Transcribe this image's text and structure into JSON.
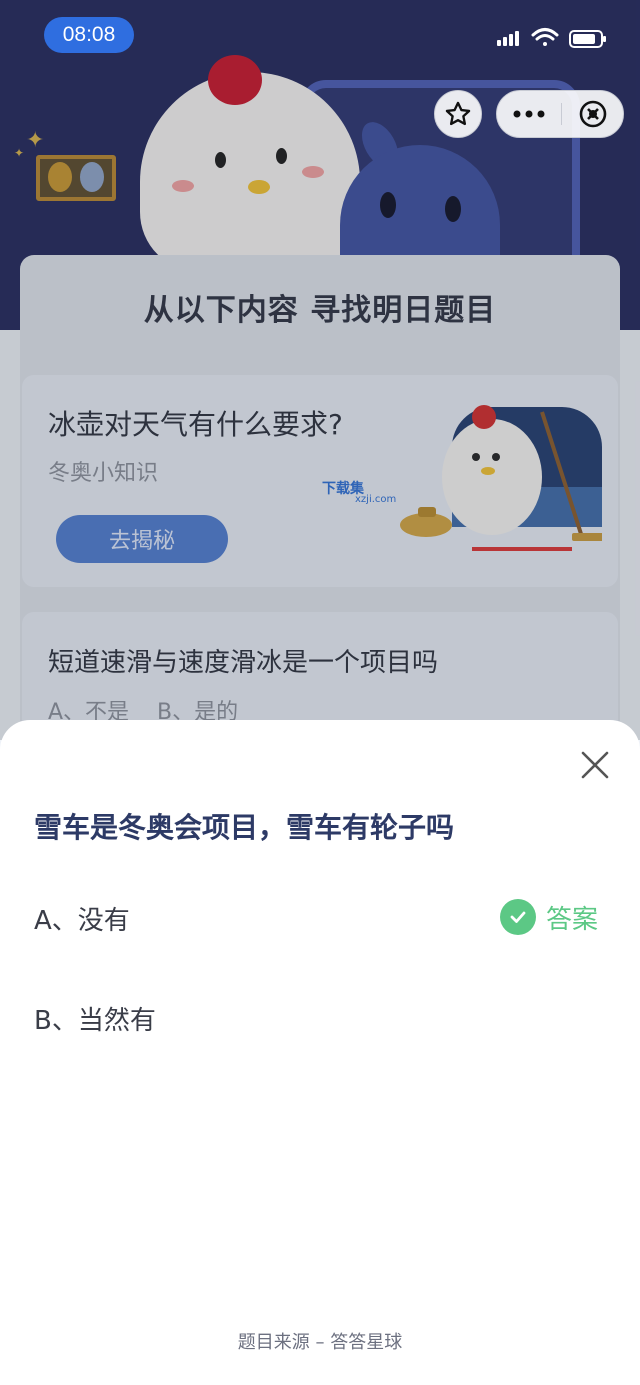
{
  "status_bar": {
    "time": "08:08"
  },
  "capsule": {
    "icons": [
      "star-icon",
      "more-icon",
      "close-circle-icon"
    ]
  },
  "banner": {
    "title": "从以下内容 寻找明日题目"
  },
  "cards": [
    {
      "title": "冰壶对天气有什么要求?",
      "subtitle": "冬奥小知识",
      "button": "去揭秘"
    },
    {
      "title": "短道速滑与速度滑冰是一个项目吗",
      "options": "A、不是    B、是的"
    }
  ],
  "watermark": {
    "brand": "下载集",
    "url": "xzji.com"
  },
  "sheet": {
    "question": "雪车是冬奥会项目，雪车有轮子吗",
    "option_a": "A、没有",
    "option_b": "B、当然有",
    "answer_label": "答案",
    "footer": "题目来源 – 答答星球"
  },
  "colors": {
    "accent": "#2f6ee0",
    "answer_green": "#5cc885",
    "question_text": "#2d3a66"
  }
}
